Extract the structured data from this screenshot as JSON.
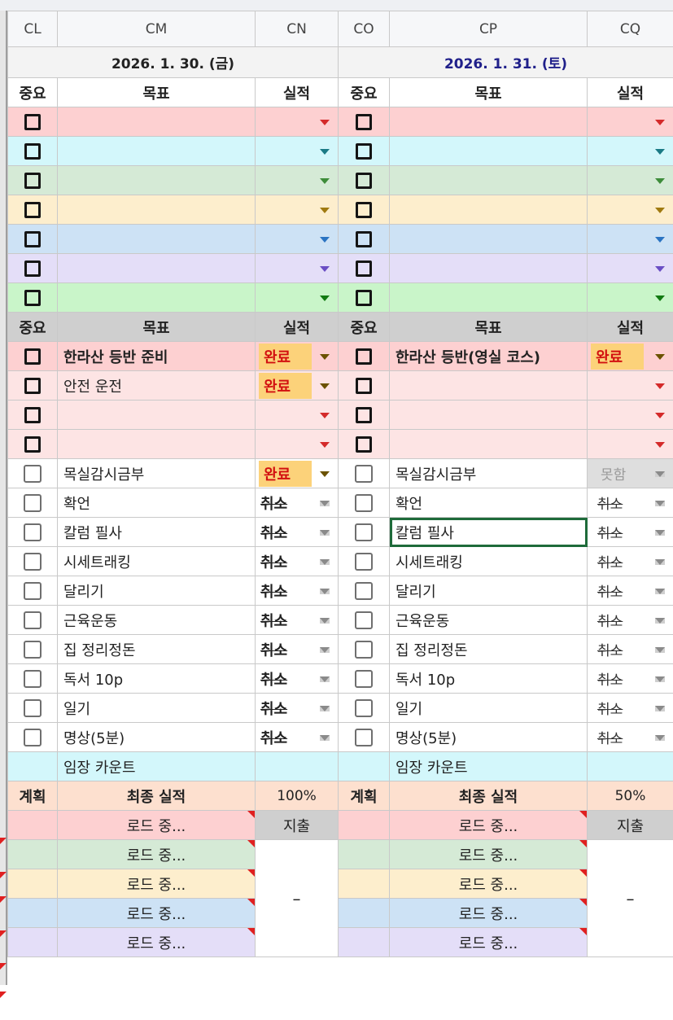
{
  "columns": [
    "CL",
    "CM",
    "CN",
    "CO",
    "CP",
    "CQ"
  ],
  "dates": {
    "fri": "2026. 1. 30. (금)",
    "sat": "2026. 1. 31. (토)"
  },
  "header": {
    "importance": "중요",
    "goal": "목표",
    "result": "실적"
  },
  "done": "완료",
  "cancel": "취소",
  "fail": "못함",
  "goals_fri": [
    "한라산 등반 준비",
    "안전 운전",
    "목실감시금부",
    "확언",
    "칼럼 필사",
    "시세트래킹",
    "달리기",
    "근육운동",
    "집 정리정돈",
    "독서 10p",
    "일기",
    "명상(5분)"
  ],
  "goals_sat": [
    "한라산 등반(영실 코스)",
    "목실감시금부",
    "확언",
    "칼럼 필사",
    "시세트래킹",
    "달리기",
    "근육운동",
    "집 정리정돈",
    "독서 10p",
    "일기",
    "명상(5분)"
  ],
  "count_label": "임장 카운트",
  "summary": {
    "plan": "계획",
    "final": "최종 실적",
    "fri_pct": "100%",
    "sat_pct": "50%"
  },
  "loading": "로드 중...",
  "expense": "지출",
  "expense_value": "–",
  "colors": {
    "selection": "#1e6b3a",
    "done_bg": "#fcd27a",
    "done_text": "#d21010"
  }
}
